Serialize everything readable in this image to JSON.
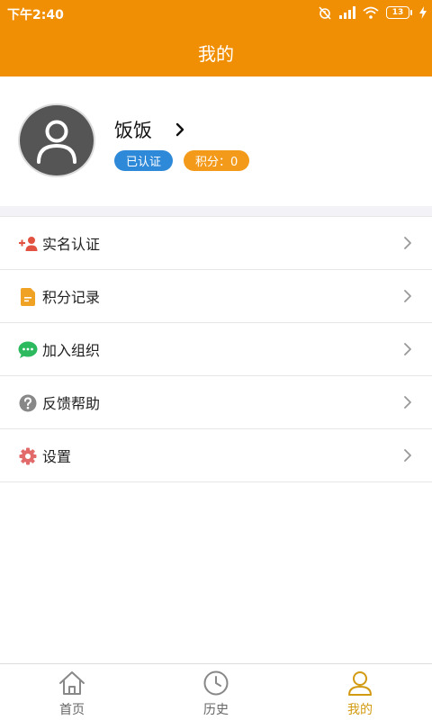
{
  "status_bar": {
    "time": "下午2:40",
    "battery_level": "13"
  },
  "header": {
    "title": "我的"
  },
  "profile": {
    "username": "饭饭",
    "badges": {
      "verified": "已认证",
      "points": "积分：0"
    }
  },
  "menu": {
    "items": [
      {
        "label": "实名认证",
        "icon": "add-person-icon",
        "icon_color": "#E25241"
      },
      {
        "label": "积分记录",
        "icon": "document-icon",
        "icon_color": "#F0A224"
      },
      {
        "label": "加入组织",
        "icon": "chat-bubble-icon",
        "icon_color": "#2DBA5F"
      },
      {
        "label": "反馈帮助",
        "icon": "question-icon",
        "icon_color": "#888888"
      },
      {
        "label": "设置",
        "icon": "gear-icon",
        "icon_color": "#E26A6A"
      }
    ]
  },
  "bottom_nav": {
    "items": [
      {
        "label": "首页",
        "icon": "home-icon",
        "active": false
      },
      {
        "label": "历史",
        "icon": "clock-icon",
        "active": false
      },
      {
        "label": "我的",
        "icon": "person-icon",
        "active": true
      }
    ]
  },
  "colors": {
    "primary": "#F18F04",
    "verified_badge": "#2F89D9",
    "points_badge": "#F39A1A",
    "active_nav": "#D29A10",
    "avatar_bg": "#555555"
  }
}
